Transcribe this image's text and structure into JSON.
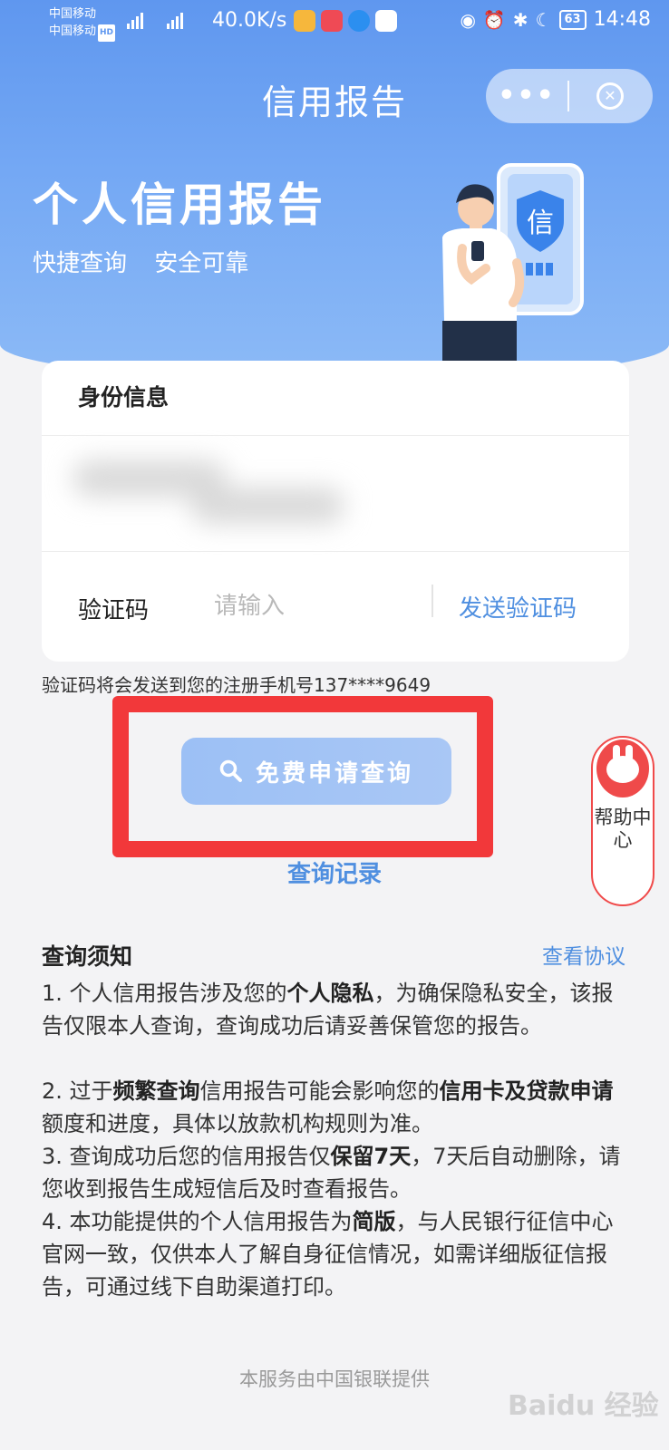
{
  "status_bar": {
    "carrier_1": "中国移动",
    "carrier_2": "中国移动",
    "hd": "HD",
    "net_speed": "40.0K/s",
    "battery": "63",
    "time": "14:48"
  },
  "nav": {
    "title": "信用报告",
    "more_label": "•••"
  },
  "banner": {
    "title": "个人信用报告",
    "sub_1": "快捷查询",
    "sub_2": "安全可靠",
    "badge_char": "信"
  },
  "card": {
    "header": "身份信息",
    "verify_label": "验证码",
    "verify_placeholder": "请输入",
    "send_code": "发送验证码"
  },
  "hint": "验证码将会发送到您的注册手机号137****9649",
  "apply_button": "免费申请查询",
  "query_record": "查询记录",
  "help": {
    "label": "帮助中心"
  },
  "notice": {
    "title": "查询须知",
    "view_agreement": "查看协议",
    "items": [
      {
        "p1": "1. 个人信用报告涉及您的",
        "b1": "个人隐私",
        "p2": "，为确保隐私安全，该报告仅限本人查询，查询成功后请妥善保管您的报告。"
      },
      {
        "p1": "2. 过于",
        "b1": "频繁查询",
        "p2": "信用报告可能会影响您的",
        "b2": "信用卡及贷款申请",
        "p3": "额度和进度，具体以放款机构规则为准。"
      },
      {
        "p1": "3. 查询成功后您的信用报告仅",
        "b1": "保留7天",
        "p2": "，7天后自动删除，请您收到报告生成短信后及时查看报告。"
      },
      {
        "p1": "4. 本功能提供的个人信用报告为",
        "b1": "简版",
        "p2": "，与人民银行征信中心官网一致，仅供本人了解自身征信情况，如需详细版征信报告，可通过线下自助渠道打印。"
      }
    ]
  },
  "footer": "本服务由中国银联提供",
  "watermark": "Baidu 经验",
  "colors": {
    "accent": "#4f8fe0",
    "hero": "#5f97ef",
    "highlight": "#f2383a"
  }
}
